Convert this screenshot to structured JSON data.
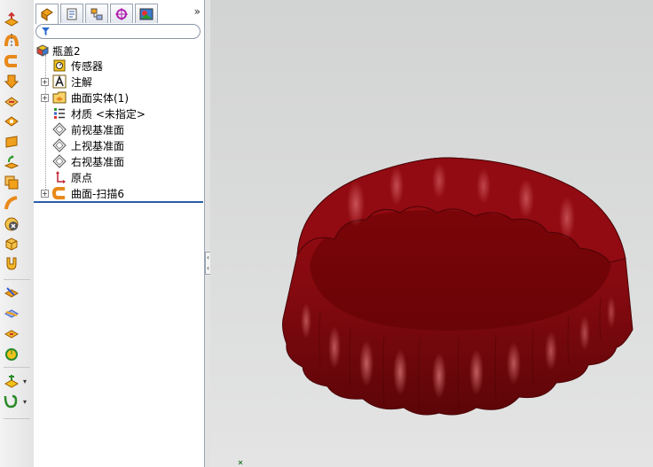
{
  "toolbar": {
    "tools": [
      {
        "icon": "extruded-surface-icon"
      },
      {
        "icon": "revolved-surface-icon"
      },
      {
        "icon": "swept-surface-icon"
      },
      {
        "icon": "lofted-surface-icon"
      },
      {
        "icon": "boundary-surface-icon"
      },
      {
        "icon": "filled-surface-icon"
      },
      {
        "icon": "planar-surface-icon"
      },
      {
        "icon": "offset-surface-icon"
      },
      {
        "icon": "ruled-surface-icon"
      },
      {
        "icon": "extend-surface-icon"
      },
      {
        "icon": "trim-surface-icon"
      },
      {
        "icon": "untrim-surface-icon"
      },
      {
        "icon": "fillet-icon"
      },
      {
        "icon": "knit-surface-icon"
      },
      {
        "icon": "delete-face-icon"
      },
      {
        "icon": "replace-face-icon"
      },
      {
        "icon": "thicken-icon"
      },
      {
        "icon": "reference-geometry-icon"
      },
      {
        "icon": "curves-icon"
      }
    ]
  },
  "panel": {
    "tabs": [
      {
        "name": "feature-manager-tab",
        "icon": "feature-tree-icon"
      },
      {
        "name": "property-manager-tab",
        "icon": "property-icon"
      },
      {
        "name": "configuration-manager-tab",
        "icon": "configuration-icon"
      },
      {
        "name": "dimxpert-manager-tab",
        "icon": "dimxpert-icon"
      },
      {
        "name": "display-manager-tab",
        "icon": "display-icon"
      }
    ],
    "more": "»",
    "tree": {
      "root": "瓶盖2",
      "items": [
        {
          "label": "传感器",
          "icon": "sensor-icon",
          "expandable": false
        },
        {
          "label": "注解",
          "icon": "annotation-icon",
          "expandable": true
        },
        {
          "label": "曲面实体(1)",
          "icon": "surface-bodies-icon",
          "expandable": true
        },
        {
          "label": "材质 <未指定>",
          "icon": "material-icon",
          "expandable": false
        },
        {
          "label": "前视基准面",
          "icon": "plane-icon",
          "expandable": false
        },
        {
          "label": "上视基准面",
          "icon": "plane-icon",
          "expandable": false
        },
        {
          "label": "右视基准面",
          "icon": "plane-icon",
          "expandable": false
        },
        {
          "label": "原点",
          "icon": "origin-icon",
          "expandable": false
        },
        {
          "label": "曲面-扫描6",
          "icon": "swept-surface-icon",
          "expandable": true
        }
      ]
    }
  },
  "viewport": {
    "model": "bottle-cap-surface",
    "model_color": "#8b0a0f"
  }
}
